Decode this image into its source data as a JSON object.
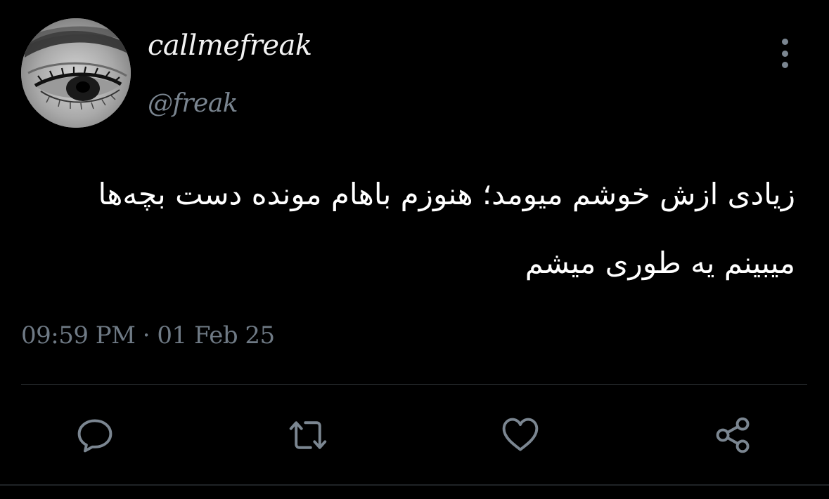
{
  "tweet": {
    "display_name": "callmefreak",
    "handle": "@freak",
    "text_line1": "زیادی ازش خوشم میومد؛ هنوزم باهام مونده دست بچه‌ها",
    "text_line2": "میبینم یه طوری میشم",
    "timestamp": "09:59 PM · 01 Feb 25"
  },
  "icons": {
    "avatar": "eye-photo",
    "more": "vertical-ellipsis-icon",
    "reply": "speech-bubble-icon",
    "retweet": "retweet-arrows-icon",
    "like": "heart-icon",
    "share": "share-nodes-icon"
  },
  "colors": {
    "background": "#000000",
    "text": "#ffffff",
    "muted": "#7a8590",
    "divider": "#2f3336",
    "icon": "#7b8691"
  }
}
